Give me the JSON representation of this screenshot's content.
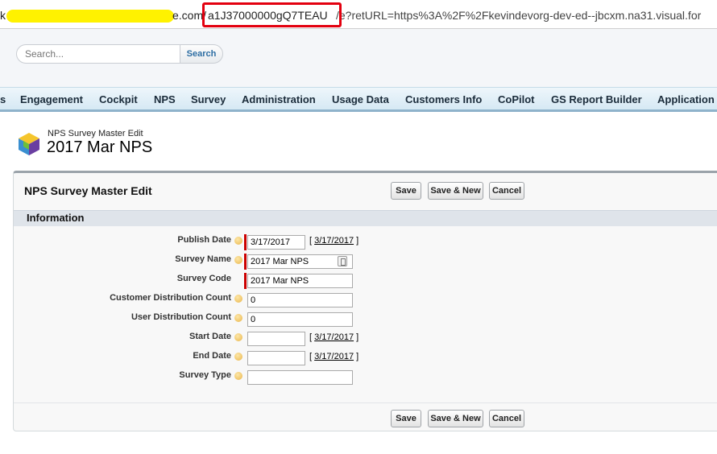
{
  "browser": {
    "url_prefix": "k",
    "url_domain": "e.com/",
    "url_record_id": "a1J37000000gQ7TEAU",
    "url_rest": "/e?retURL=https%3A%2F%2Fkevindevorg-dev-ed--jbcxm.na31.visual.for"
  },
  "search": {
    "placeholder": "Search...",
    "button_label": "Search"
  },
  "tabs": [
    {
      "label": "s"
    },
    {
      "label": "Engagement"
    },
    {
      "label": "Cockpit"
    },
    {
      "label": "NPS"
    },
    {
      "label": "Survey"
    },
    {
      "label": "Administration"
    },
    {
      "label": "Usage Data"
    },
    {
      "label": "Customers Info"
    },
    {
      "label": "CoPilot"
    },
    {
      "label": "GS Report Builder"
    },
    {
      "label": "Application"
    }
  ],
  "page_header": {
    "subtitle": "NPS Survey Master Edit",
    "title": "2017 Mar NPS",
    "icon": "cube-icon"
  },
  "panel": {
    "title": "NPS Survey Master Edit",
    "buttons": {
      "save": "Save",
      "save_new": "Save & New",
      "cancel": "Cancel"
    },
    "section_title": "Information"
  },
  "fields": [
    {
      "label": "Publish Date",
      "value": "3/17/2017",
      "required": true,
      "date_link": "3/17/2017"
    },
    {
      "label": "Survey Name",
      "value": "2017 Mar NPS",
      "required": true
    },
    {
      "label": "Survey Code",
      "value": "2017 Mar NPS",
      "required": true
    },
    {
      "label": "Customer Distribution Count",
      "value": "0"
    },
    {
      "label": "User Distribution Count",
      "value": "0"
    },
    {
      "label": "Start Date",
      "value": "",
      "date_link": "3/17/2017"
    },
    {
      "label": "End Date",
      "value": "",
      "date_link": "3/17/2017"
    },
    {
      "label": "Survey Type",
      "value": ""
    }
  ],
  "colors": {
    "required_bar": "#cc0000",
    "url_highlight": "#e3000f",
    "redaction": "#fff200"
  }
}
